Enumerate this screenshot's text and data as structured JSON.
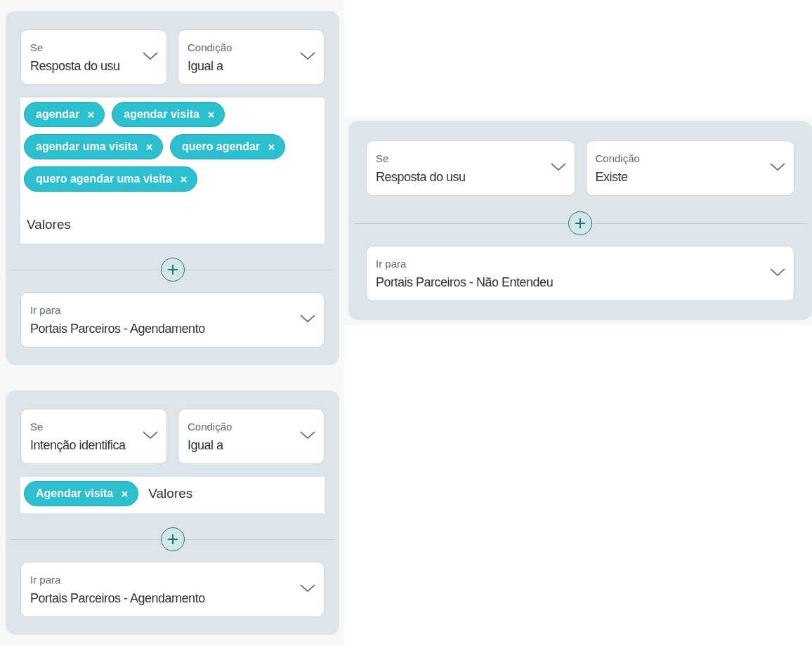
{
  "left_column": [
    {
      "if": {
        "label": "Se",
        "value": "Resposta do usu"
      },
      "condition": {
        "label": "Condição",
        "value": "Igual a"
      },
      "values": {
        "tags": [
          "agendar",
          "agendar visita",
          "agendar uma visita",
          "quero agendar",
          "quero agendar uma visita"
        ],
        "placeholder": "Valores"
      },
      "goto": {
        "label": "Ir para",
        "value": "Portais Parceiros - Agendamento"
      }
    },
    {
      "if": {
        "label": "Se",
        "value": "Intenção identifica"
      },
      "condition": {
        "label": "Condição",
        "value": "Igual a"
      },
      "values": {
        "tags": [
          "Agendar visita"
        ],
        "placeholder": "Valores"
      },
      "goto": {
        "label": "Ir para",
        "value": "Portais Parceiros - Agendamento"
      }
    }
  ],
  "right_column": [
    {
      "if": {
        "label": "Se",
        "value": "Resposta do usu"
      },
      "condition": {
        "label": "Condição",
        "value": "Existe"
      },
      "goto": {
        "label": "Ir para",
        "value": "Portais Parceiros - Não Entendeu"
      }
    }
  ]
}
